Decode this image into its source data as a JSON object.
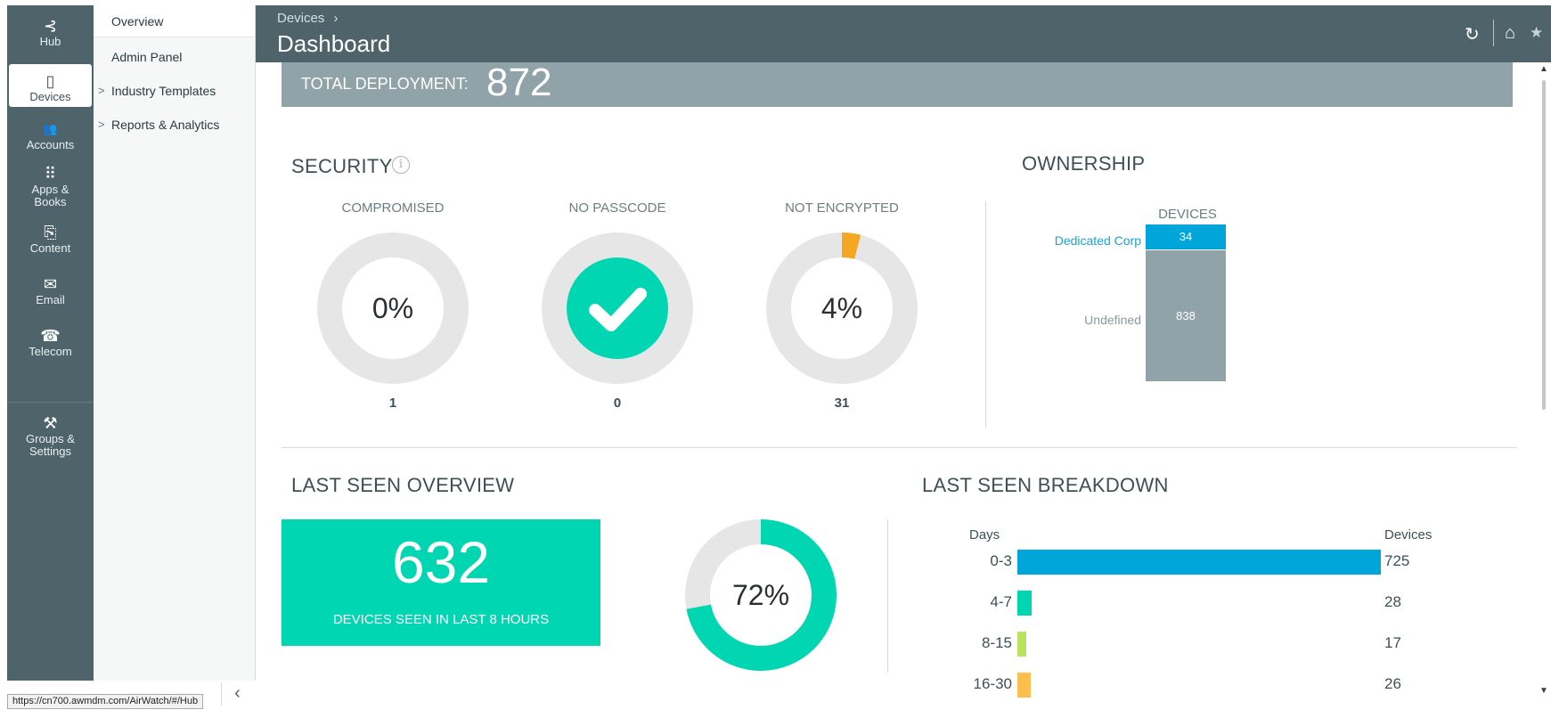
{
  "rail": {
    "items": [
      {
        "label": "Hub",
        "icon": "hub-icon",
        "glyph": "⊰"
      },
      {
        "label": "Devices",
        "icon": "mobile-device-icon",
        "glyph": "▯"
      },
      {
        "label": "Accounts",
        "icon": "users-icon",
        "glyph": "👥"
      },
      {
        "label": "Apps &",
        "label2": "Books",
        "icon": "apps-grid-icon",
        "glyph": "⠿"
      },
      {
        "label": "Content",
        "icon": "content-docs-icon",
        "glyph": "⎘"
      },
      {
        "label": "Email",
        "icon": "envelope-icon",
        "glyph": "✉"
      },
      {
        "label": "Telecom",
        "icon": "phone-icon",
        "glyph": "☎"
      },
      {
        "label": "Groups &",
        "label2": "Settings",
        "icon": "tools-icon",
        "glyph": "⚒"
      }
    ]
  },
  "subnav": {
    "items": [
      {
        "label": "Overview",
        "expandable": false
      },
      {
        "label": "Admin Panel",
        "expandable": false
      },
      {
        "label": "Industry Templates",
        "expandable": true
      },
      {
        "label": "Reports & Analytics",
        "expandable": true
      }
    ],
    "chevron": ">",
    "collapse": "‹"
  },
  "status_url": "https://cn700.awmdm.com/AirWatch/#/Hub",
  "header": {
    "breadcrumb": "Devices",
    "breadcrumb_sep": "›",
    "title": "Dashboard",
    "refresh_glyph": "↻",
    "home_glyph": "⌂",
    "star_glyph": "★"
  },
  "total": {
    "label": "TOTAL DEPLOYMENT:",
    "value": "872"
  },
  "security": {
    "title": "SECURITY",
    "info": "i",
    "donuts": [
      {
        "label": "COMPROMISED",
        "pct_text": "0%",
        "fraction": 0.0,
        "count": "1"
      },
      {
        "label": "NO PASSCODE",
        "pct_text": "",
        "fraction": 1.0,
        "count": "0",
        "check": true
      },
      {
        "label": "NOT ENCRYPTED",
        "pct_text": "4%",
        "fraction": 0.04,
        "count": "31"
      }
    ]
  },
  "ownership": {
    "title": "OWNERSHIP",
    "column_header": "DEVICES",
    "rows": [
      {
        "label": "Dedicated Corp",
        "value": 34,
        "value_text": "34"
      },
      {
        "label": "Undefined",
        "value": 838,
        "value_text": "838"
      }
    ]
  },
  "last_seen_overview": {
    "title": "LAST SEEN OVERVIEW",
    "value": "632",
    "caption": "DEVICES SEEN IN LAST 8 HOURS",
    "pct_text": "72%",
    "fraction": 0.72
  },
  "last_seen_breakdown": {
    "title": "LAST SEEN BREAKDOWN",
    "x_header": "Days",
    "y_header": "Devices"
  },
  "chart_data": {
    "type": "bar",
    "orientation": "horizontal",
    "title": "LAST SEEN BREAKDOWN",
    "xlabel": "Days",
    "ylabel": "Devices",
    "categories": [
      "0-3",
      "4-7",
      "8-15",
      "16-30"
    ],
    "values": [
      725,
      28,
      17,
      26
    ],
    "value_labels": [
      "725",
      "28",
      "17",
      "26"
    ]
  },
  "colors": {
    "teal": "#00d6b1",
    "blue": "#00a5d9",
    "lime": "#b8e35a",
    "orange": "#fcbf4e",
    "warn": "#f5a623",
    "slate": "#4f646a",
    "gray_bar": "#8fa3a8",
    "track": "#e6e6e6"
  }
}
